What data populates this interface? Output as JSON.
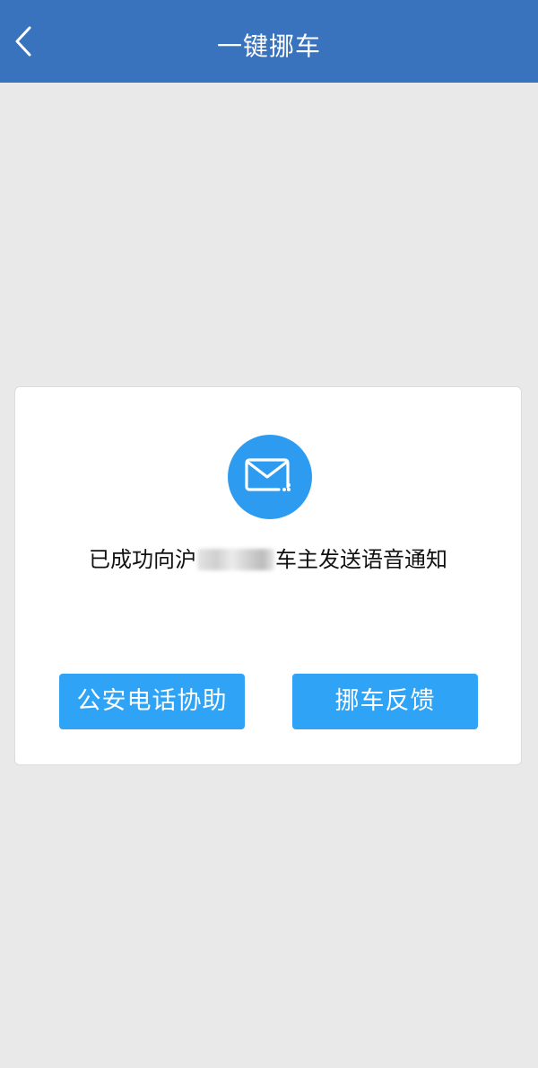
{
  "header": {
    "title": "一键挪车",
    "back_icon": "chevron-left-icon"
  },
  "card": {
    "icon": "mail-icon",
    "icon_color": "#2d9cf0",
    "message_prefix": "已成功向沪",
    "message_suffix": "车主发送语音通知",
    "buttons": {
      "police_help": "公安电话协助",
      "feedback": "挪车反馈"
    }
  },
  "colors": {
    "header_bg": "#3a73bd",
    "page_bg": "#e9e9e9",
    "button_bg": "#2fa3f5"
  }
}
